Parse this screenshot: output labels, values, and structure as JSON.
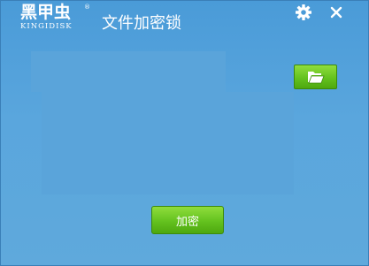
{
  "brand": {
    "logo_cn": "黑甲虫",
    "registered_mark": "®",
    "logo_en": "KINGIDISK"
  },
  "window": {
    "title": "文件加密锁"
  },
  "titlebar": {
    "settings_icon": "gear-icon",
    "close_icon": "close-icon"
  },
  "toolbar": {
    "folder_icon": "folder-open-icon"
  },
  "actions": {
    "encrypt_label": "加密"
  },
  "colors": {
    "background": "#5aa6dd",
    "accent_green": "#64c21f"
  }
}
